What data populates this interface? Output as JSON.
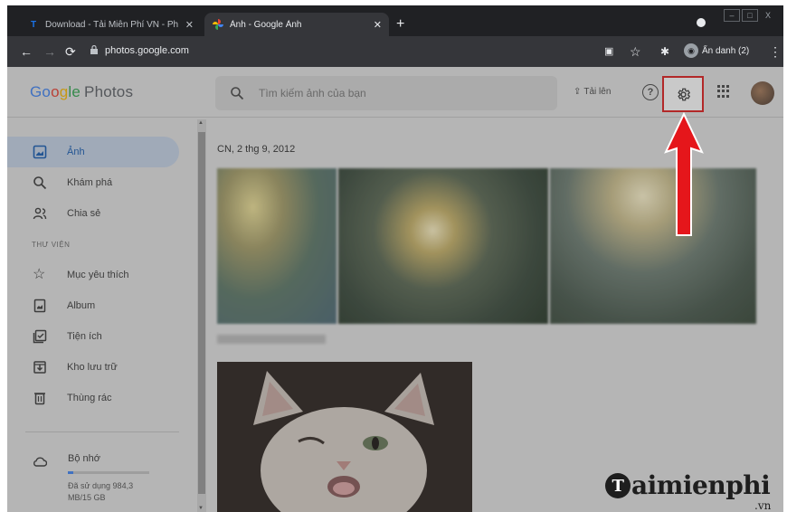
{
  "browser": {
    "tabs": [
      {
        "title": "Download - Tải Miễn Phí VN - Ph",
        "favicon": "taimienphi-t-icon",
        "active": false
      },
      {
        "title": "Ảnh - Google Ảnh",
        "favicon": "google-photos-pinwheel-icon",
        "active": true
      }
    ],
    "new_tab_symbol": "+",
    "url": "photos.google.com",
    "incognito_label": "Ẩn danh (2)",
    "window_controls": [
      "–",
      "□",
      "X"
    ]
  },
  "app": {
    "logo_google": [
      "Go",
      "o",
      "g",
      "le"
    ],
    "logo_product": "Photos",
    "search_placeholder": "Tìm kiếm ảnh của bạn",
    "upload_label": "Tải lên",
    "help_symbol": "?"
  },
  "sidebar": {
    "items": [
      {
        "label": "Ảnh",
        "icon": "photo-icon",
        "active": true
      },
      {
        "label": "Khám phá",
        "icon": "search-icon",
        "active": false
      },
      {
        "label": "Chia sẻ",
        "icon": "people-icon",
        "active": false
      }
    ],
    "library_label": "THƯ VIỆN",
    "library_items": [
      {
        "label": "Mục yêu thích",
        "icon": "star-icon"
      },
      {
        "label": "Album",
        "icon": "album-icon"
      },
      {
        "label": "Tiện ích",
        "icon": "utilities-icon"
      },
      {
        "label": "Kho lưu trữ",
        "icon": "archive-icon"
      },
      {
        "label": "Thùng rác",
        "icon": "trash-icon"
      }
    ],
    "storage": {
      "title": "Bộ nhớ",
      "used_text": "Đã sử dụng 984,3 MB/15 GB",
      "used_fraction": 0.066
    }
  },
  "main": {
    "groups": [
      {
        "date": "CN, 2 thg 9, 2012",
        "photo_count": 3
      },
      {
        "date": "",
        "photo_count": 1
      }
    ]
  },
  "annotation": {
    "highlight_color": "#e02020",
    "target": "settings-gear-icon"
  },
  "watermark": {
    "brand": "aimienphi",
    "suffix": ".vn"
  }
}
